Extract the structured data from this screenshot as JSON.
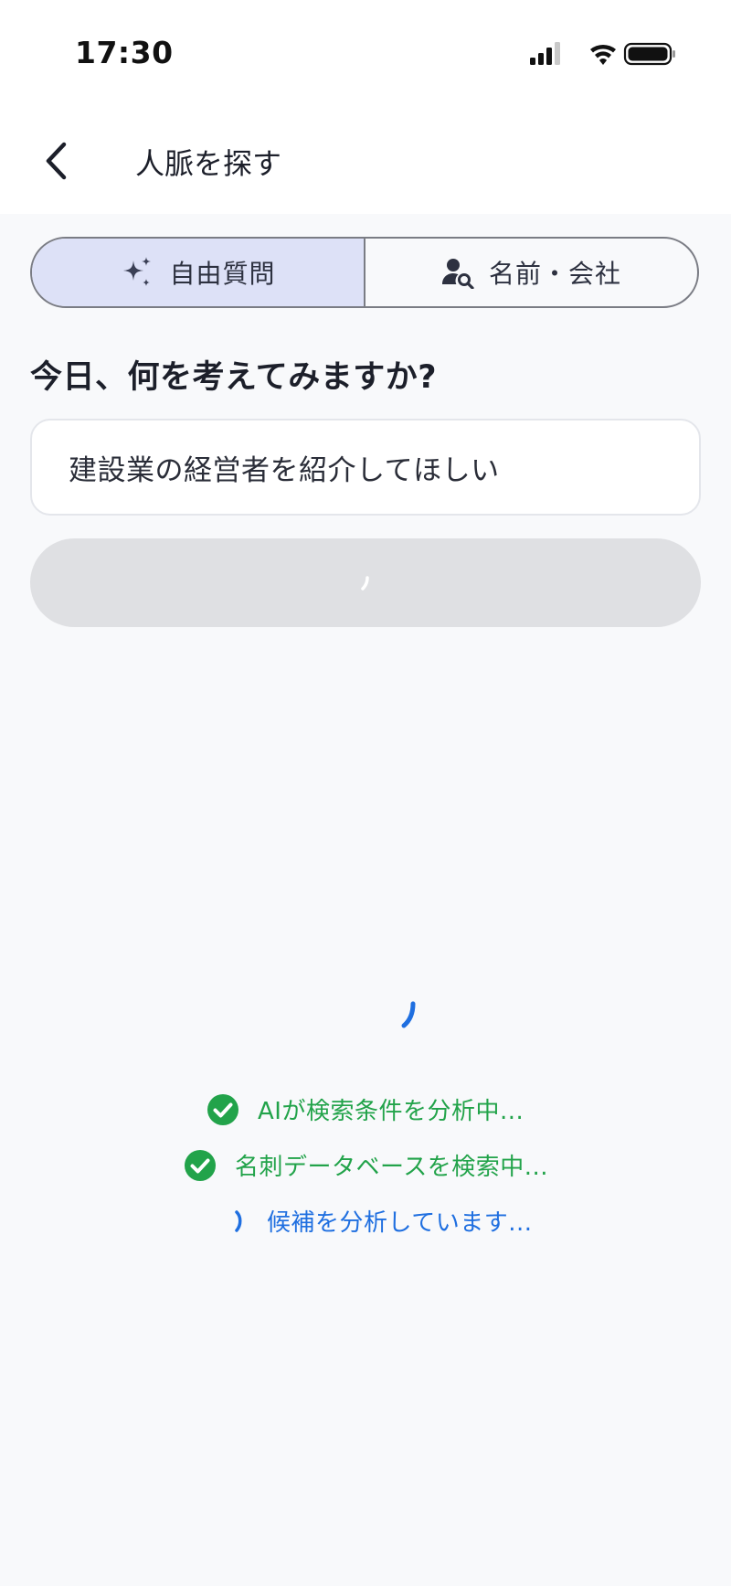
{
  "status_bar": {
    "time": "17:30"
  },
  "header": {
    "title": "人脈を探す"
  },
  "tabs": [
    {
      "label": "自由質問",
      "icon": "sparkle-icon",
      "active": true
    },
    {
      "label": "名前・会社",
      "icon": "person-search-icon",
      "active": false
    }
  ],
  "question": {
    "heading": "今日、何を考えてみますか?",
    "value": "建設業の経営者を紹介してほしい"
  },
  "progress": {
    "steps": [
      {
        "label": "AIが検索条件を分析中...",
        "state": "done"
      },
      {
        "label": "名刺データベースを検索中...",
        "state": "done"
      },
      {
        "label": "候補を分析しています...",
        "state": "running"
      }
    ]
  },
  "colors": {
    "accent_blue": "#1f6fe0",
    "success_green": "#22a34a",
    "active_tab_bg": "#dde1f7",
    "button_disabled_bg": "#dfe0e3"
  }
}
